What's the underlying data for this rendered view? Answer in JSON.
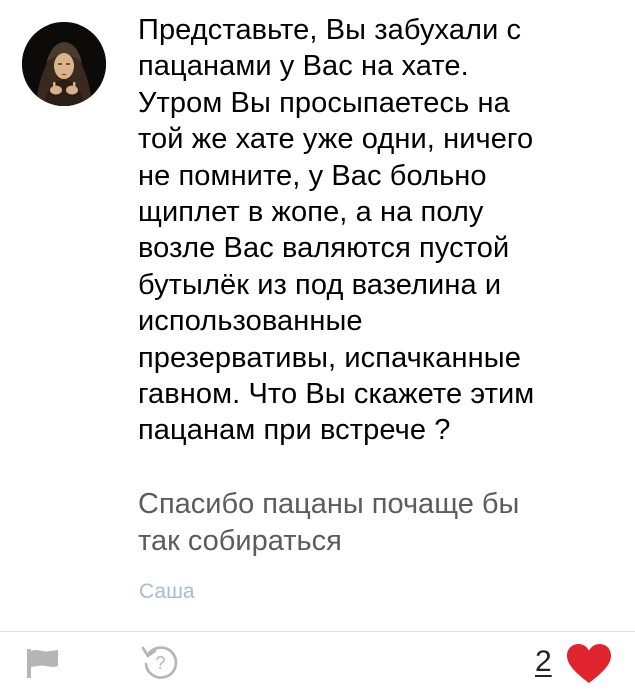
{
  "post": {
    "question": "Представьте, Вы забухали с\nпацанами у Вас на хате.\nУтром Вы просыпаетесь на\nтой же хате уже одни, ничего\nне помните, у Вас больно\nщиплет в жопе, а на полу\nвозле Вас валяются пустой\nбутылёк из под вазелина и\nиспользованные\nпрезервативы, испачканные\nгавном. Что Вы скажете этим\nпацанам при встрече ?",
    "answer": "Спасибо пацаны почаще бы\nтак собираться",
    "author": "Саша"
  },
  "actions": {
    "like_count": "2",
    "icons": {
      "report": "flag-icon",
      "repeat": "question-sync-icon",
      "like": "heart-icon"
    }
  },
  "colors": {
    "author_link": "#a4bdd6",
    "answer_text": "#5c5c5c",
    "icon_gray": "#b5b5b5",
    "heart": "#e1232d"
  }
}
